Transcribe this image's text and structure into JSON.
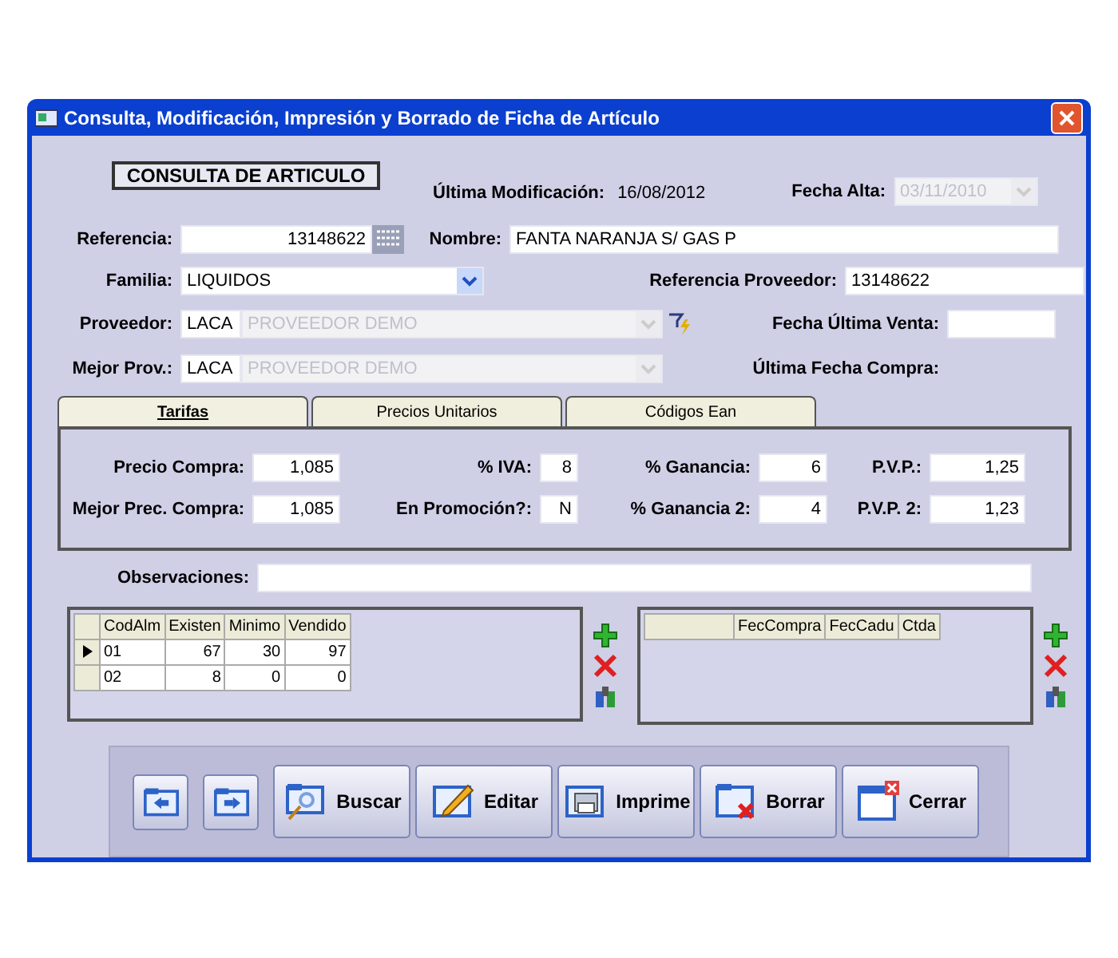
{
  "window": {
    "title": "Consulta, Modificación, Impresión y Borrado de Ficha de Artículo"
  },
  "header": {
    "section_title": "CONSULTA DE ARTICULO",
    "last_modified_label": "Última Modificación:",
    "last_modified": "16/08/2012",
    "date_added_label": "Fecha Alta:",
    "date_added": "03/11/2010",
    "date_added_disabled": true
  },
  "referencia": {
    "label": "Referencia:",
    "value": "13148622"
  },
  "nombre": {
    "label": "Nombre:",
    "value": "FANTA NARANJA S/ GAS P"
  },
  "familia": {
    "label": "Familia:",
    "value": "LIQUIDOS"
  },
  "referencia_proveedor": {
    "label": "Referencia Proveedor:",
    "value": "13148622"
  },
  "proveedor": {
    "label": "Proveedor:",
    "code": "LACA",
    "name": "PROVEEDOR DEMO",
    "disabled": true
  },
  "fecha_ultima_venta": {
    "label": "Fecha Última Venta:"
  },
  "mejor_prov": {
    "label": "Mejor Prov.:",
    "code": "LACA",
    "name": "PROVEEDOR DEMO",
    "disabled": true
  },
  "ultima_fecha_compra": {
    "label": "Última Fecha Compra:"
  },
  "tabs": [
    {
      "label": "Tarifas",
      "selected": true
    },
    {
      "label": "Precios Unitarios",
      "selected": false
    },
    {
      "label": "Códigos Ean",
      "selected": false
    }
  ],
  "tarifas": [
    [
      {
        "label": "Precio Compra:",
        "value": "1,085"
      },
      {
        "label": "% IVA:",
        "value": "8"
      },
      {
        "label": "% Ganancia:",
        "value": "6"
      },
      {
        "label": "P.V.P.:",
        "value": "1,25"
      }
    ],
    [
      {
        "label": "Mejor Prec. Compra:",
        "value": "1,085"
      },
      {
        "label": "En Promoción?:",
        "value": "N"
      },
      {
        "label": "% Ganancia 2:",
        "value": "4"
      },
      {
        "label": "P.V.P. 2:",
        "value": "1,23"
      }
    ]
  ],
  "observaciones": {
    "label": "Observaciones:"
  },
  "stock_grid": {
    "columns": [
      "CodAlm",
      "Existen",
      "Minimo",
      "Vendido"
    ],
    "rows": [
      {
        "cells": [
          "01",
          "67",
          "30",
          "97"
        ],
        "selected": true
      },
      {
        "cells": [
          "02",
          "8",
          "0",
          "0"
        ],
        "selected": false
      }
    ]
  },
  "purchase_grid": {
    "columns": [
      "FecCompra",
      "FecCadu",
      "Ctda"
    ]
  },
  "toolbar": [
    {
      "kind": "prev"
    },
    {
      "kind": "next"
    },
    {
      "kind": "search",
      "label": "Buscar"
    },
    {
      "kind": "edit",
      "label": "Editar"
    },
    {
      "kind": "print",
      "label": "Imprime"
    },
    {
      "kind": "delete",
      "label": "Borrar"
    },
    {
      "kind": "close",
      "label": "Cerrar"
    }
  ]
}
